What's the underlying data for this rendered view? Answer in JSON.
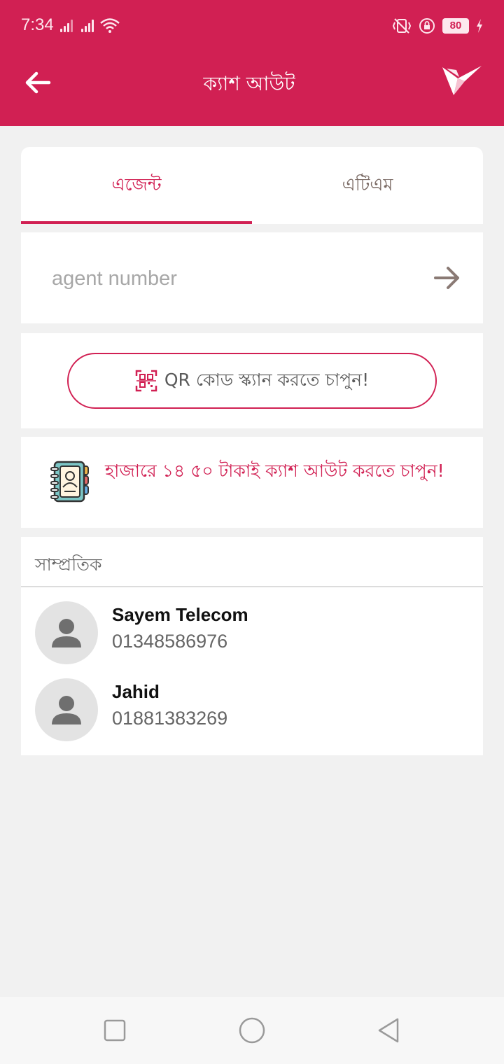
{
  "status_bar": {
    "time": "7:34",
    "battery": "80",
    "icons": [
      "signal-icon",
      "signal-icon",
      "wifi-icon",
      "vibrate-icon",
      "lock-icon",
      "battery-icon",
      "charging-icon"
    ]
  },
  "app_bar": {
    "title": "ক্যাশ আউট",
    "back_icon": "arrow-left-icon",
    "logo_icon": "bird-logo-icon"
  },
  "tabs": [
    {
      "label": "এজেন্ট",
      "active": true
    },
    {
      "label": "এটিএম",
      "active": false
    }
  ],
  "agent_input": {
    "placeholder": "agent number",
    "value": "",
    "submit_icon": "arrow-right-icon"
  },
  "qr_button": {
    "label": "QR কোড স্ক্যান করতে চাপুন!",
    "icon": "qr-scan-icon"
  },
  "promo": {
    "text": "হাজারে ১৪ ৫০ টাকাই ক্যাশ আউট করতে চাপুন!",
    "icon": "contact-book-icon"
  },
  "recent": {
    "header": "সাম্প্রতিক",
    "contacts": [
      {
        "name": "Sayem Telecom",
        "number": "01348586976"
      },
      {
        "name": "Jahid",
        "number": "01881383269"
      }
    ]
  },
  "nav_bar": {
    "buttons": [
      "recents-square-icon",
      "home-circle-icon",
      "back-triangle-icon"
    ]
  },
  "colors": {
    "brand": "#d12053",
    "background": "#f1f1f1",
    "card": "#ffffff"
  }
}
